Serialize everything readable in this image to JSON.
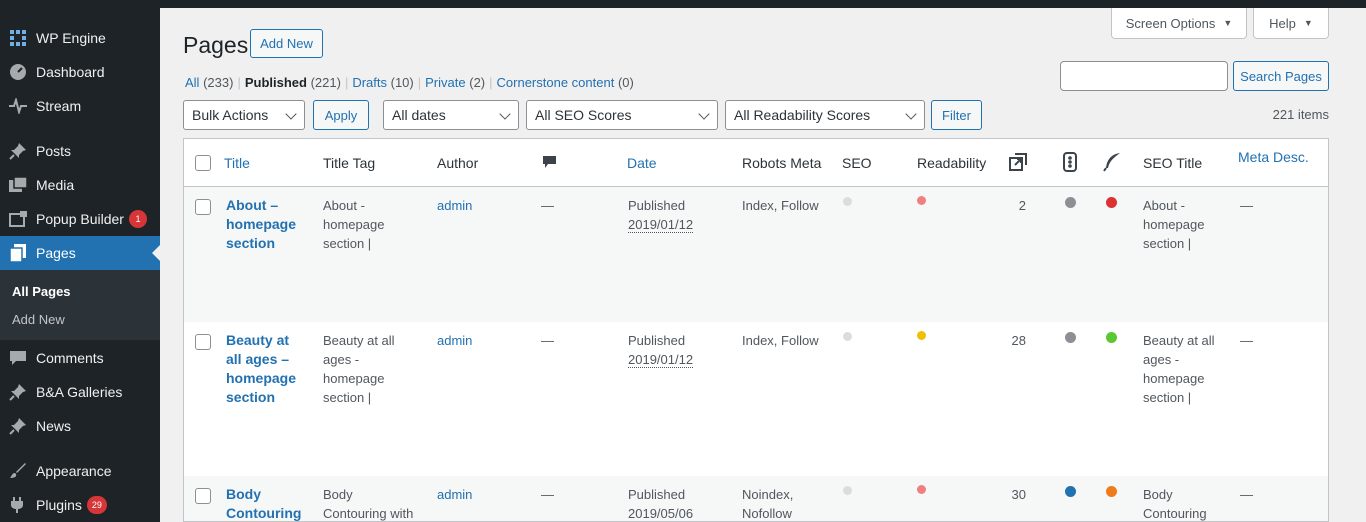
{
  "sidebar": {
    "items": [
      {
        "label": "WP Engine",
        "icon": "grid-icon"
      },
      {
        "label": "Dashboard",
        "icon": "dashboard-icon"
      },
      {
        "label": "Stream",
        "icon": "activity-icon"
      },
      {
        "label": "Posts",
        "icon": "pin-icon"
      },
      {
        "label": "Media",
        "icon": "media-icon"
      },
      {
        "label": "Popup Builder",
        "icon": "popup-icon",
        "badge": "1"
      },
      {
        "label": "Pages",
        "icon": "pages-icon"
      },
      {
        "label": "Comments",
        "icon": "comment-icon"
      },
      {
        "label": "B&A Galleries",
        "icon": "pin-icon"
      },
      {
        "label": "News",
        "icon": "pin-icon"
      },
      {
        "label": "Appearance",
        "icon": "brush-icon"
      },
      {
        "label": "Plugins",
        "icon": "plugin-icon",
        "badge": "29"
      }
    ],
    "submenu": [
      {
        "label": "All Pages"
      },
      {
        "label": "Add New"
      }
    ]
  },
  "header": {
    "title": "Pages",
    "add_new": "Add New",
    "screen_options": "Screen Options",
    "help": "Help"
  },
  "views": [
    {
      "label": "All",
      "count": "(233)"
    },
    {
      "label": "Published",
      "count": "(221)"
    },
    {
      "label": "Drafts",
      "count": "(10)"
    },
    {
      "label": "Private",
      "count": "(2)"
    },
    {
      "label": "Cornerstone content",
      "count": "(0)"
    }
  ],
  "search": {
    "button": "Search Pages",
    "value": ""
  },
  "filters": {
    "bulk_actions": "Bulk Actions",
    "apply": "Apply",
    "dates": "All dates",
    "seo_scores": "All SEO Scores",
    "readability_scores": "All Readability Scores",
    "filter": "Filter",
    "items_count": "221 items"
  },
  "table": {
    "columns": {
      "title": "Title",
      "title_tag": "Title Tag",
      "author": "Author",
      "date": "Date",
      "robots_meta": "Robots Meta",
      "seo": "SEO",
      "readability": "Readability",
      "seo_title": "SEO Title",
      "meta_desc": "Meta Desc."
    },
    "rows": [
      {
        "title_lines": [
          "About –",
          "homepage",
          "section"
        ],
        "title_tag_lines": [
          "About -",
          "homepage",
          "section |"
        ],
        "author": "admin",
        "comments": "—",
        "status": "Published",
        "date": "2019/01/12",
        "robots_lines": [
          "Index, Follow"
        ],
        "links": "2",
        "seo_title_lines": [
          "About -",
          "homepage",
          "section |"
        ],
        "meta_desc": "—",
        "colors": {
          "seo": "#dcdcde",
          "readability": "#f08080",
          "c1": "#8c8f94",
          "c2": "#dc3232"
        }
      },
      {
        "title_lines": [
          "Beauty at",
          "all ages –",
          "homepage",
          "section"
        ],
        "title_tag_lines": [
          "Beauty at all",
          "ages -",
          "homepage",
          "section |"
        ],
        "author": "admin",
        "comments": "—",
        "status": "Published",
        "date": "2019/01/12",
        "robots_lines": [
          "Index, Follow"
        ],
        "links": "28",
        "seo_title_lines": [
          "Beauty at all",
          "ages -",
          "homepage",
          "section |"
        ],
        "meta_desc": "—",
        "colors": {
          "seo": "#dcdcde",
          "readability": "#f0c000",
          "c1": "#8c8f94",
          "c2": "#5ac832"
        }
      },
      {
        "title_lines": [
          "Body",
          "Contouring"
        ],
        "title_tag_lines": [
          "Body",
          "Contouring with"
        ],
        "author": "admin",
        "comments": "—",
        "status": "Published",
        "date": "2019/05/06",
        "robots_lines": [
          "Noindex,",
          "Nofollow"
        ],
        "links": "30",
        "seo_title_lines": [
          "Body",
          "Contouring"
        ],
        "meta_desc": "—",
        "colors": {
          "seo": "#dcdcde",
          "readability": "#f08080",
          "c1": "#2271b1",
          "c2": "#ee7c1b"
        }
      }
    ]
  }
}
